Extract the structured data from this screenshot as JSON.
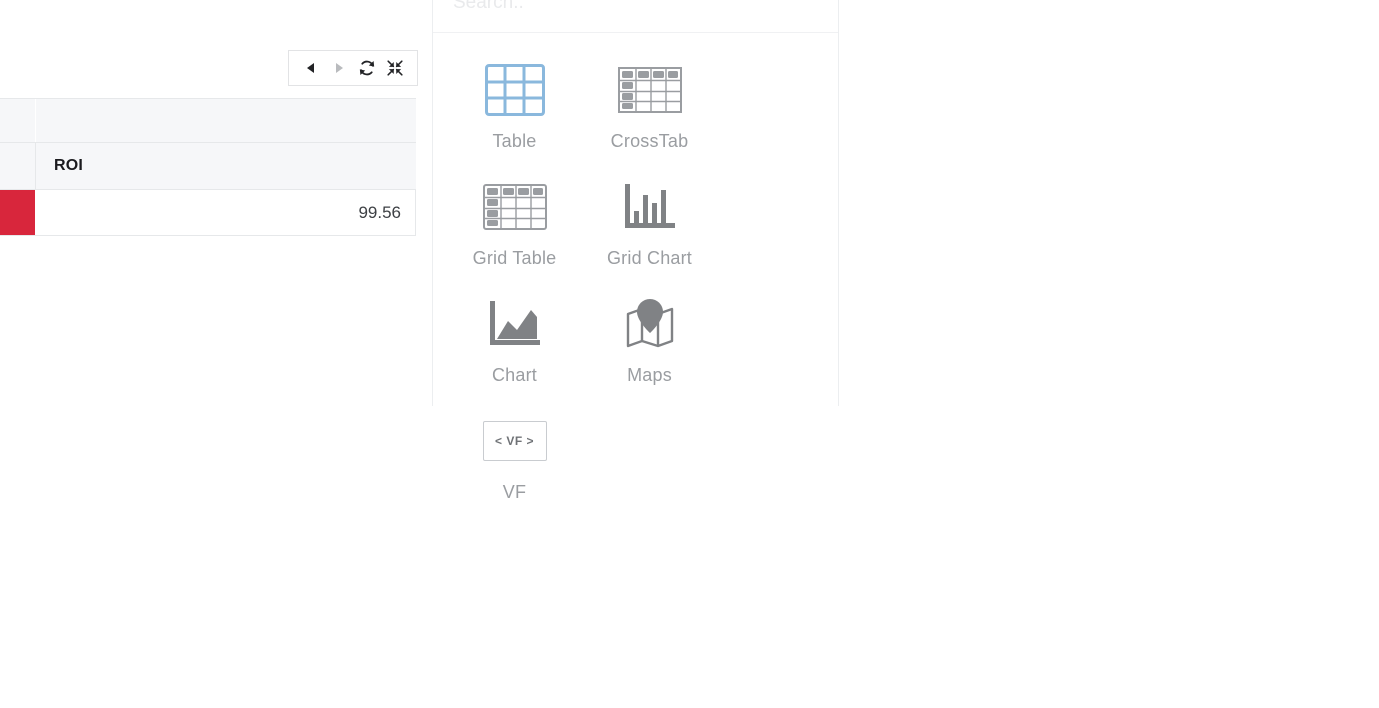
{
  "toolbar": {
    "back_label": "back-navigation",
    "forward_label": "forward-navigation",
    "refresh_label": "refresh",
    "collapse_label": "exit-fullscreen",
    "highlight_color": "#f57c1f",
    "highlighted_control": "exit-fullscreen"
  },
  "table": {
    "column_header": "ROI",
    "rows": [
      {
        "indicator": "l",
        "value": "99.56",
        "indicator_color": "#d8263c"
      }
    ]
  },
  "viz_panel": {
    "search": {
      "placeholder": "Search..",
      "value": ""
    },
    "items": [
      {
        "label": "Table",
        "icon": "table-grid-icon",
        "selected": true
      },
      {
        "label": "CrossTab",
        "icon": "crosstab-icon",
        "selected": false
      },
      {
        "label": "Grid Table",
        "icon": "grid-table-icon",
        "selected": false
      },
      {
        "label": "Grid Chart",
        "icon": "bar-chart-icon",
        "selected": false
      },
      {
        "label": "Chart",
        "icon": "area-chart-icon",
        "selected": false
      },
      {
        "label": "Maps",
        "icon": "map-pin-icon",
        "selected": false
      },
      {
        "label": "VF",
        "icon": "vf-tag-icon",
        "selected": false,
        "icon_text": "< VF >"
      }
    ],
    "accent_selected_color": "#8ab8dd",
    "icon_color": "#808285"
  }
}
